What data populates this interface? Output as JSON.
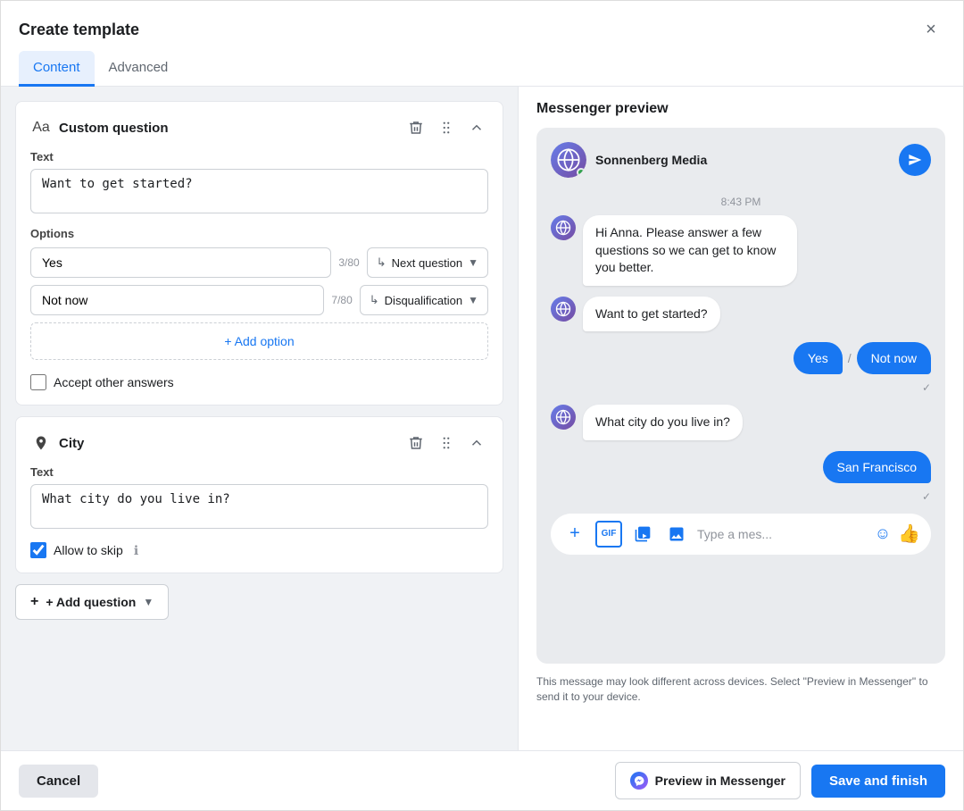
{
  "modal": {
    "title": "Create template",
    "close_label": "×"
  },
  "tabs": [
    {
      "id": "content",
      "label": "Content",
      "active": true
    },
    {
      "id": "advanced",
      "label": "Advanced",
      "active": false
    }
  ],
  "custom_question": {
    "title": "Custom question",
    "text_label": "Text",
    "text_value": "Want to get started?",
    "options_label": "Options",
    "options": [
      {
        "value": "Yes",
        "char_count": "3/80",
        "action": "Next question"
      },
      {
        "value": "Not now",
        "char_count": "7/80",
        "action": "Disqualification"
      }
    ],
    "add_option_label": "+ Add option",
    "accept_other_label": "Accept other answers"
  },
  "city_question": {
    "title": "City",
    "text_label": "Text",
    "text_value": "What city do you live in?",
    "allow_skip_label": "Allow to skip"
  },
  "add_question_label": "+ Add question",
  "preview": {
    "title": "Messenger preview",
    "page_name": "Sonnenberg Media",
    "timestamp": "8:43 PM",
    "messages": [
      {
        "type": "left",
        "text": "Hi Anna. Please answer a few questions so we can get to know you better."
      },
      {
        "type": "left",
        "text": "Want to get started?"
      },
      {
        "type": "right_options",
        "options": [
          "Yes",
          "Not now"
        ]
      },
      {
        "type": "left",
        "text": "What city do you live in?"
      },
      {
        "type": "right_single",
        "text": "San Francisco"
      }
    ],
    "input_placeholder": "Type a mes...",
    "note": "This message may look different across devices. Select \"Preview in Messenger\" to send it to your device."
  },
  "footer": {
    "cancel_label": "Cancel",
    "preview_messenger_label": "Preview in Messenger",
    "save_finish_label": "Save and finish"
  }
}
